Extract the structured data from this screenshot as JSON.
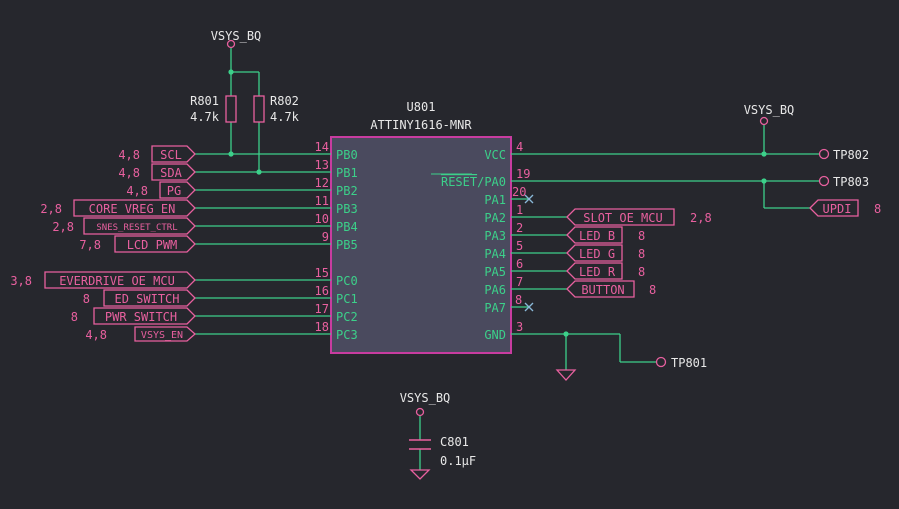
{
  "power_net": "VSYS_BQ",
  "ic": {
    "ref": "U801",
    "part": "ATTINY1616-MNR"
  },
  "resistors": [
    {
      "ref": "R801",
      "value": "4.7k"
    },
    {
      "ref": "R802",
      "value": "4.7k"
    }
  ],
  "capacitor": {
    "ref": "C801",
    "value": "0.1µF"
  },
  "left_pins": [
    {
      "num": "14",
      "name": "PB0",
      "net": "SCL",
      "xref": "4,8"
    },
    {
      "num": "13",
      "name": "PB1",
      "net": "SDA",
      "xref": "4,8"
    },
    {
      "num": "12",
      "name": "PB2",
      "net": "PG",
      "xref": "4,8"
    },
    {
      "num": "11",
      "name": "PB3",
      "net": "CORE_VREG_EN",
      "xref": "2,8"
    },
    {
      "num": "10",
      "name": "PB4",
      "net": "SNES_RESET_CTRL",
      "xref": "2,8"
    },
    {
      "num": "9",
      "name": "PB5",
      "net": "LCD_PWM",
      "xref": "7,8"
    },
    {
      "num": "15",
      "name": "PC0",
      "net": "EVERDRIVE_OE_MCU",
      "xref": "3,8"
    },
    {
      "num": "16",
      "name": "PC1",
      "net": "ED_SWITCH",
      "xref": "8"
    },
    {
      "num": "17",
      "name": "PC2",
      "net": "PWR_SWITCH",
      "xref": "8"
    },
    {
      "num": "18",
      "name": "PC3",
      "net": "VSYS_EN",
      "xref": "4,8"
    }
  ],
  "right_pins": [
    {
      "num": "4",
      "name": "VCC"
    },
    {
      "num": "19",
      "name_over": "RESET",
      "name_rest": "/PA0"
    },
    {
      "num": "20",
      "name": "PA1"
    },
    {
      "num": "1",
      "name": "PA2",
      "net": "SLOT_OE_MCU",
      "xref": "2,8"
    },
    {
      "num": "2",
      "name": "PA3",
      "net": "LED_B",
      "xref": "8"
    },
    {
      "num": "5",
      "name": "PA4",
      "net": "LED_G",
      "xref": "8"
    },
    {
      "num": "6",
      "name": "PA5",
      "net": "LED_R",
      "xref": "8"
    },
    {
      "num": "7",
      "name": "PA6",
      "net": "BUTTON",
      "xref": "8"
    },
    {
      "num": "8",
      "name": "PA7"
    },
    {
      "num": "3",
      "name": "GND"
    }
  ],
  "updi": {
    "net": "UPDI",
    "xref": "8"
  },
  "test_points": {
    "tp802": "TP802",
    "tp803": "TP803",
    "tp801": "TP801"
  },
  "colors": {
    "wire": "#3cd08a",
    "label": "#e8609f",
    "ic_fill": "#4a4a5e",
    "ic_border": "#c83ca0",
    "background": "#26272d"
  }
}
